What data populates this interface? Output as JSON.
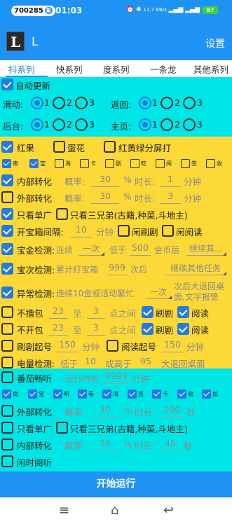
{
  "status_bar": {
    "id_badge": "700285",
    "id_badge_icon": "象",
    "time": "01:03",
    "net_speed": "11.7 KB/s",
    "battery": "67"
  },
  "app": {
    "title": "L",
    "logo_letter": "L",
    "settings": "设置"
  },
  "tabs": [
    {
      "label": "抖系列",
      "active": true
    },
    {
      "label": "快系列",
      "active": false
    },
    {
      "label": "度系列",
      "active": false
    },
    {
      "label": "一条龙",
      "active": false
    },
    {
      "label": "其他系列",
      "active": false
    }
  ],
  "auto_update": {
    "label": "自动更新",
    "checked": true
  },
  "radio_groups": {
    "swipe": {
      "label": "滑动:",
      "options": [
        "1",
        "2",
        "3"
      ],
      "selected": 0
    },
    "back": {
      "label": "返回:",
      "options": [
        "1",
        "2",
        "3"
      ],
      "selected": 0
    },
    "background": {
      "label": "后台:",
      "options": [
        "1",
        "2",
        "3"
      ],
      "selected": 0
    },
    "home": {
      "label": "主页:",
      "options": [
        "1",
        "2",
        "3"
      ],
      "selected": 0
    }
  },
  "modes": {
    "red_fruit": {
      "label": "红果",
      "checked": true
    },
    "egg_flower": {
      "label": "蛋花",
      "checked": false
    },
    "split": {
      "label": "红黄绿分屏打",
      "checked": false
    }
  },
  "small_opts_1": [
    {
      "label": "南",
      "checked": true
    },
    {
      "label": "宝",
      "checked": true
    },
    {
      "label": "海",
      "checked": false
    },
    {
      "label": "卡",
      "checked": false
    },
    {
      "label": "剧",
      "checked": false
    },
    {
      "label": "吃",
      "checked": false
    },
    {
      "label": "阅",
      "checked": false
    },
    {
      "label": "签",
      "checked": false
    },
    {
      "label": "收",
      "checked": false
    }
  ],
  "inner_transfer": {
    "label": "内部转化",
    "checked": true,
    "rate_label": "概率:",
    "rate": "30",
    "rate_unit": "%",
    "dur_label": "时长:",
    "dur": "1",
    "dur_unit": "分钟"
  },
  "outer_transfer": {
    "label": "外部转化",
    "checked": false,
    "rate_label": "概率:",
    "rate": "30",
    "rate_unit": "%",
    "dur_label": "时长:",
    "dur": "3",
    "dur_unit": "分钟"
  },
  "single_ad": {
    "label": "只看单广",
    "checked": true,
    "brothers_label": "只看三兄弟(古籍,种菜,斗地主)",
    "brothers_checked": false
  },
  "chest_interval": {
    "label": "开宝箱间隔:",
    "checked": true,
    "value": "10",
    "unit": "分钟",
    "idle_drama": "闲刷剧",
    "idle_drama_checked": false,
    "idle_read": "闲阅读",
    "idle_read_checked": false
  },
  "gold_check": {
    "label": "宝金检测:",
    "checked": true,
    "cont": "连续",
    "once": "一次",
    "below": "低于",
    "amount": "500",
    "after": "金币后",
    "next": "继续其…"
  },
  "chest_check": {
    "label": "宝次检测:",
    "checked": true,
    "cumul": "累计打宝箱",
    "count": "999",
    "after": "次后",
    "next": "继续其他任务"
  },
  "abnormal_check": {
    "label": "异常检测:",
    "checked": true,
    "desc": "连续10金或活动繁忙",
    "once": "一次",
    "after_line1": "次后大退回桌",
    "after_line2": "面,文字报警"
  },
  "no_bag": {
    "label": "不撸包",
    "checked": false,
    "from": "23",
    "to_label": "至",
    "to": "3",
    "between": "点之间",
    "drama": "刷剧",
    "drama_checked": true,
    "read": "阅读",
    "read_checked": true
  },
  "no_open_bag": {
    "label": "不开包",
    "checked": false,
    "from": "23",
    "to_label": "至",
    "to": "3",
    "between": "点之间",
    "drama": "刷剧",
    "drama_checked": true,
    "read": "阅读",
    "read_checked": true
  },
  "drama_start": {
    "label": "刷剧起号",
    "checked": false,
    "value": "150",
    "unit": "分钟",
    "read_label": "阅读起号",
    "read_checked": false,
    "read_value": "150",
    "read_unit": "分钟"
  },
  "battery_check": {
    "label": "电量检测:",
    "checked": false,
    "low_label": "低于",
    "low": "10",
    "or_label": "或高于",
    "high": "95",
    "action": "大退回桌面"
  },
  "tomato": {
    "label": "番茄畅听",
    "checked": false,
    "run_label": "运行时长",
    "run_value": "9999",
    "run_unit": "分钟"
  },
  "small_opts_2": [
    {
      "label": "南",
      "checked": true
    },
    {
      "label": "宝",
      "checked": true
    },
    {
      "label": "听",
      "checked": true
    },
    {
      "label": "看",
      "checked": true
    },
    {
      "label": "海",
      "checked": true
    },
    {
      "label": "签",
      "checked": true
    },
    {
      "label": "卡",
      "checked": true
    },
    {
      "label": "收",
      "checked": true
    },
    {
      "label": "加",
      "checked": true
    }
  ],
  "outer_transfer_2": {
    "label": "外部转化",
    "checked": false,
    "rate_label": "概率:",
    "rate": "30",
    "rate_unit": "%",
    "dur_label": "时长:",
    "dur": "200",
    "dur_unit": "秒"
  },
  "single_ad_2": {
    "label": "只看单广",
    "checked": false,
    "brothers_label": "只看三兄弟(古籍,种菜,斗地主)",
    "brothers_checked": false
  },
  "inner_transfer_2": {
    "label": "内部转化",
    "checked": false,
    "rate_label": "概率:",
    "rate": "30",
    "rate_unit": "%",
    "dur_label": "时长:",
    "dur": "45",
    "dur_unit": "秒"
  },
  "idle_read": {
    "label": "闲时阅听",
    "checked": false
  },
  "start_button": "开始运行",
  "nav": {
    "menu": "≡",
    "home": "⌂",
    "back": "↩"
  }
}
